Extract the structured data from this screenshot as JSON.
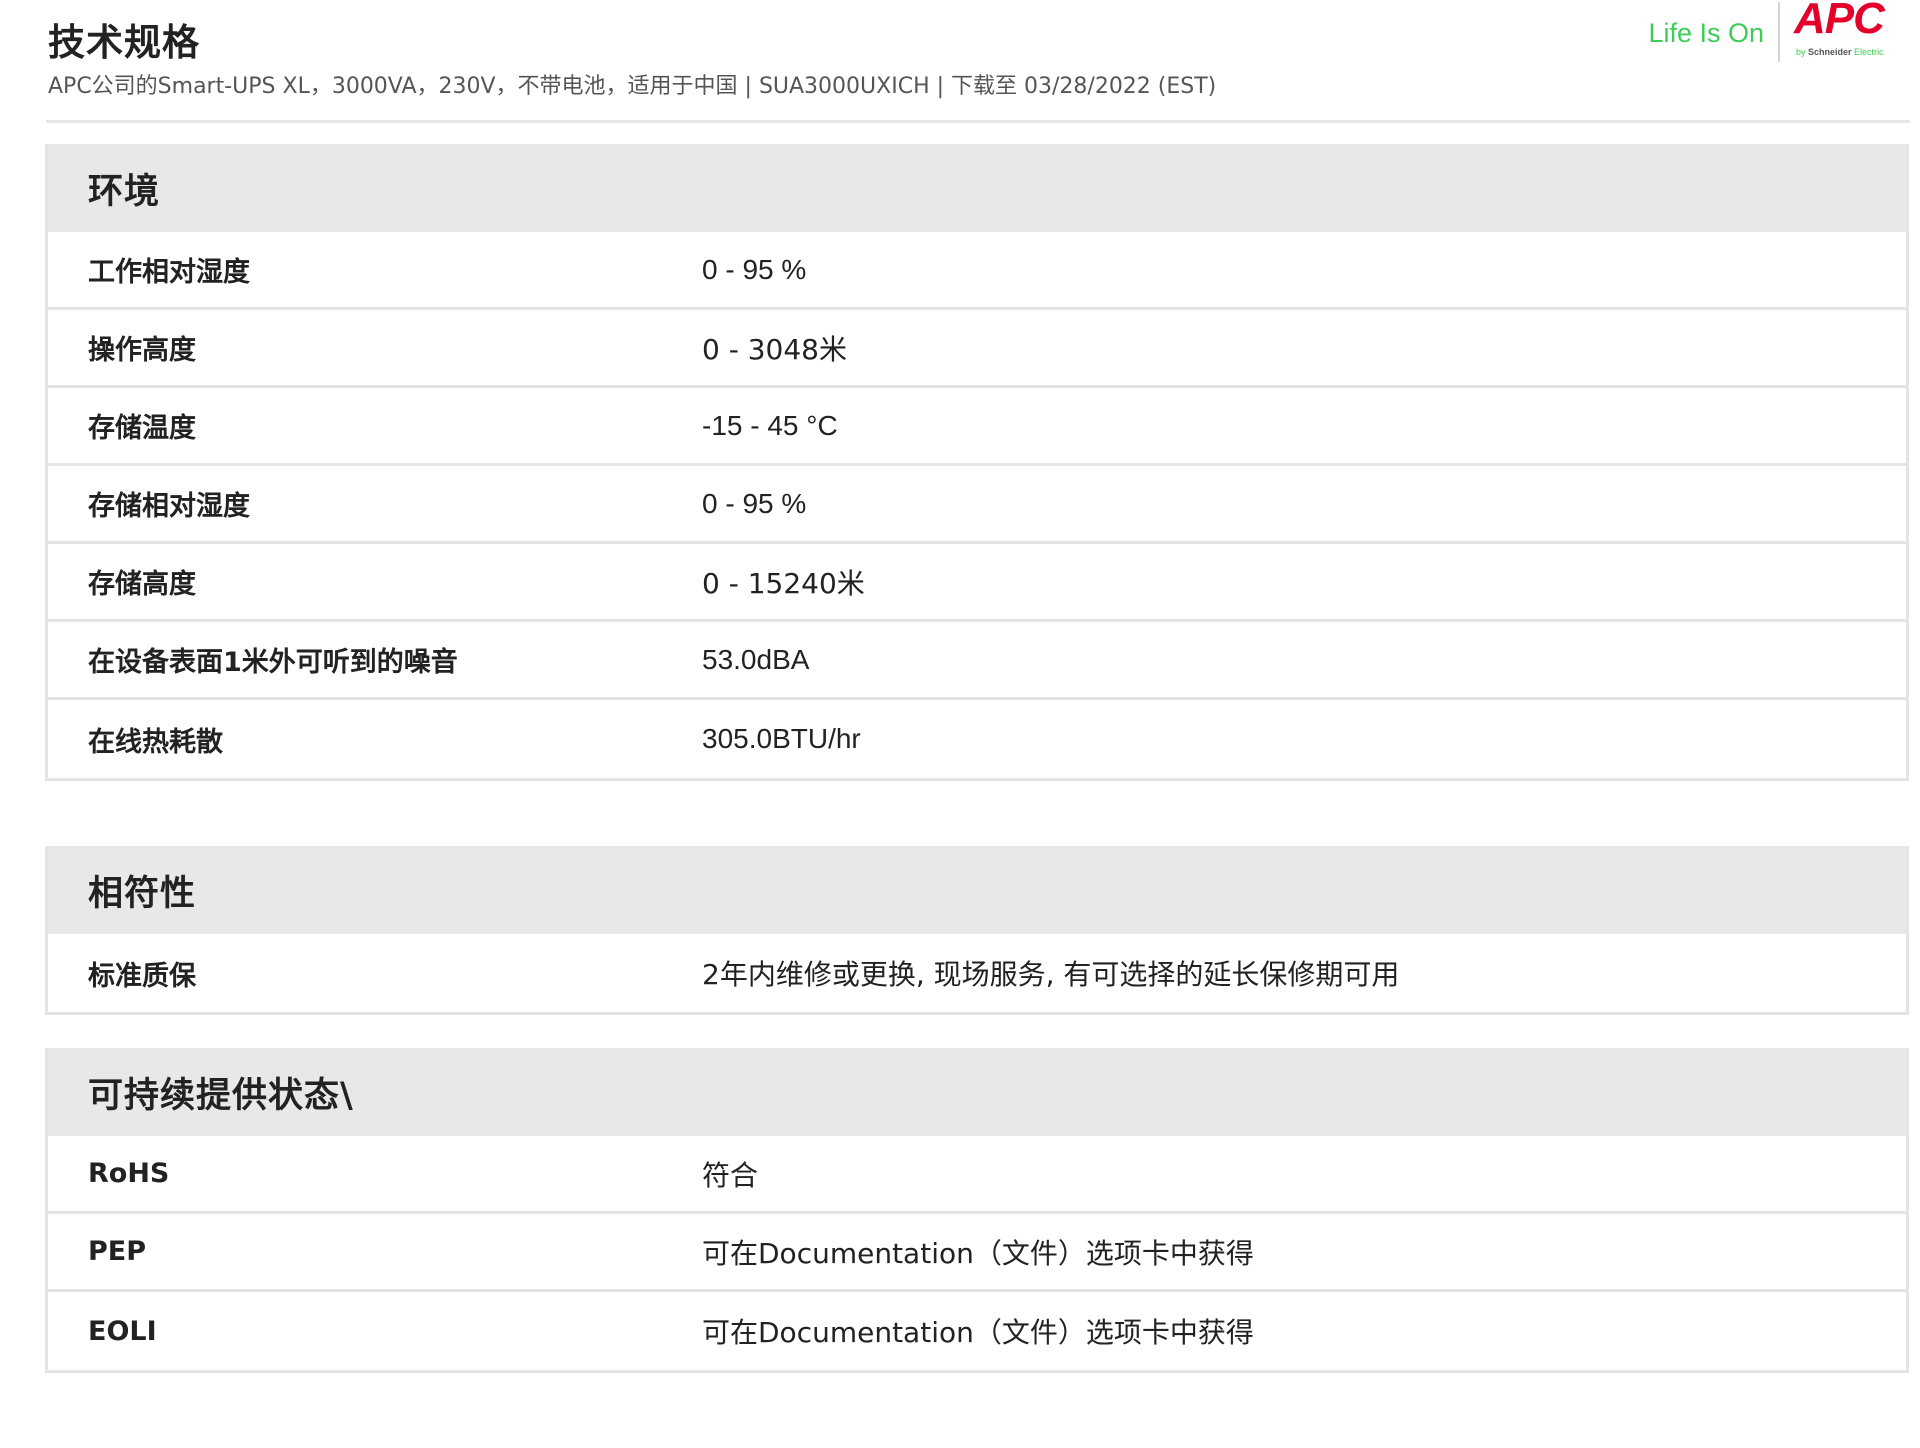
{
  "header": {
    "title": "技术规格",
    "subtitle": "APC公司的Smart-UPS XL，3000VA，230V，不带电池，适用于中国 | SUA3000UXICH | 下载至 03/28/2022 (EST)",
    "brand_tagline": "Life Is On",
    "logo_word": "APC",
    "logo_sub_prefix": "by ",
    "logo_sub_company": "Schneider",
    "logo_sub_suffix": " Electric",
    "colors": {
      "tagline_green": "#3dcd58",
      "logo_red": "#e4002b"
    }
  },
  "sections": [
    {
      "title": "环境",
      "rows": [
        {
          "label": "工作相对湿度",
          "value": "0 - 95 %"
        },
        {
          "label": "操作高度",
          "value": "0 - 3048米"
        },
        {
          "label": "存储温度",
          "value": "-15 - 45 °C"
        },
        {
          "label": "存储相对湿度",
          "value": "0 - 95 %"
        },
        {
          "label": "存储高度",
          "value": "0 - 15240米"
        },
        {
          "label": "在设备表面1米外可听到的噪音",
          "value": "53.0dBA"
        },
        {
          "label": "在线热耗散",
          "value": "305.0BTU/hr"
        }
      ]
    },
    {
      "title": "相符性",
      "rows": [
        {
          "label": "标准质保",
          "value": "2年内维修或更换, 现场服务, 有可选择的延长保修期可用"
        }
      ]
    },
    {
      "title": "可持续提供状态\\",
      "rows": [
        {
          "label": "RoHS",
          "value": "符合"
        },
        {
          "label": "PEP",
          "value": "可在Documentation（文件）选项卡中获得"
        },
        {
          "label": "EOLI",
          "value": "可在Documentation（文件）选项卡中获得"
        }
      ]
    }
  ]
}
